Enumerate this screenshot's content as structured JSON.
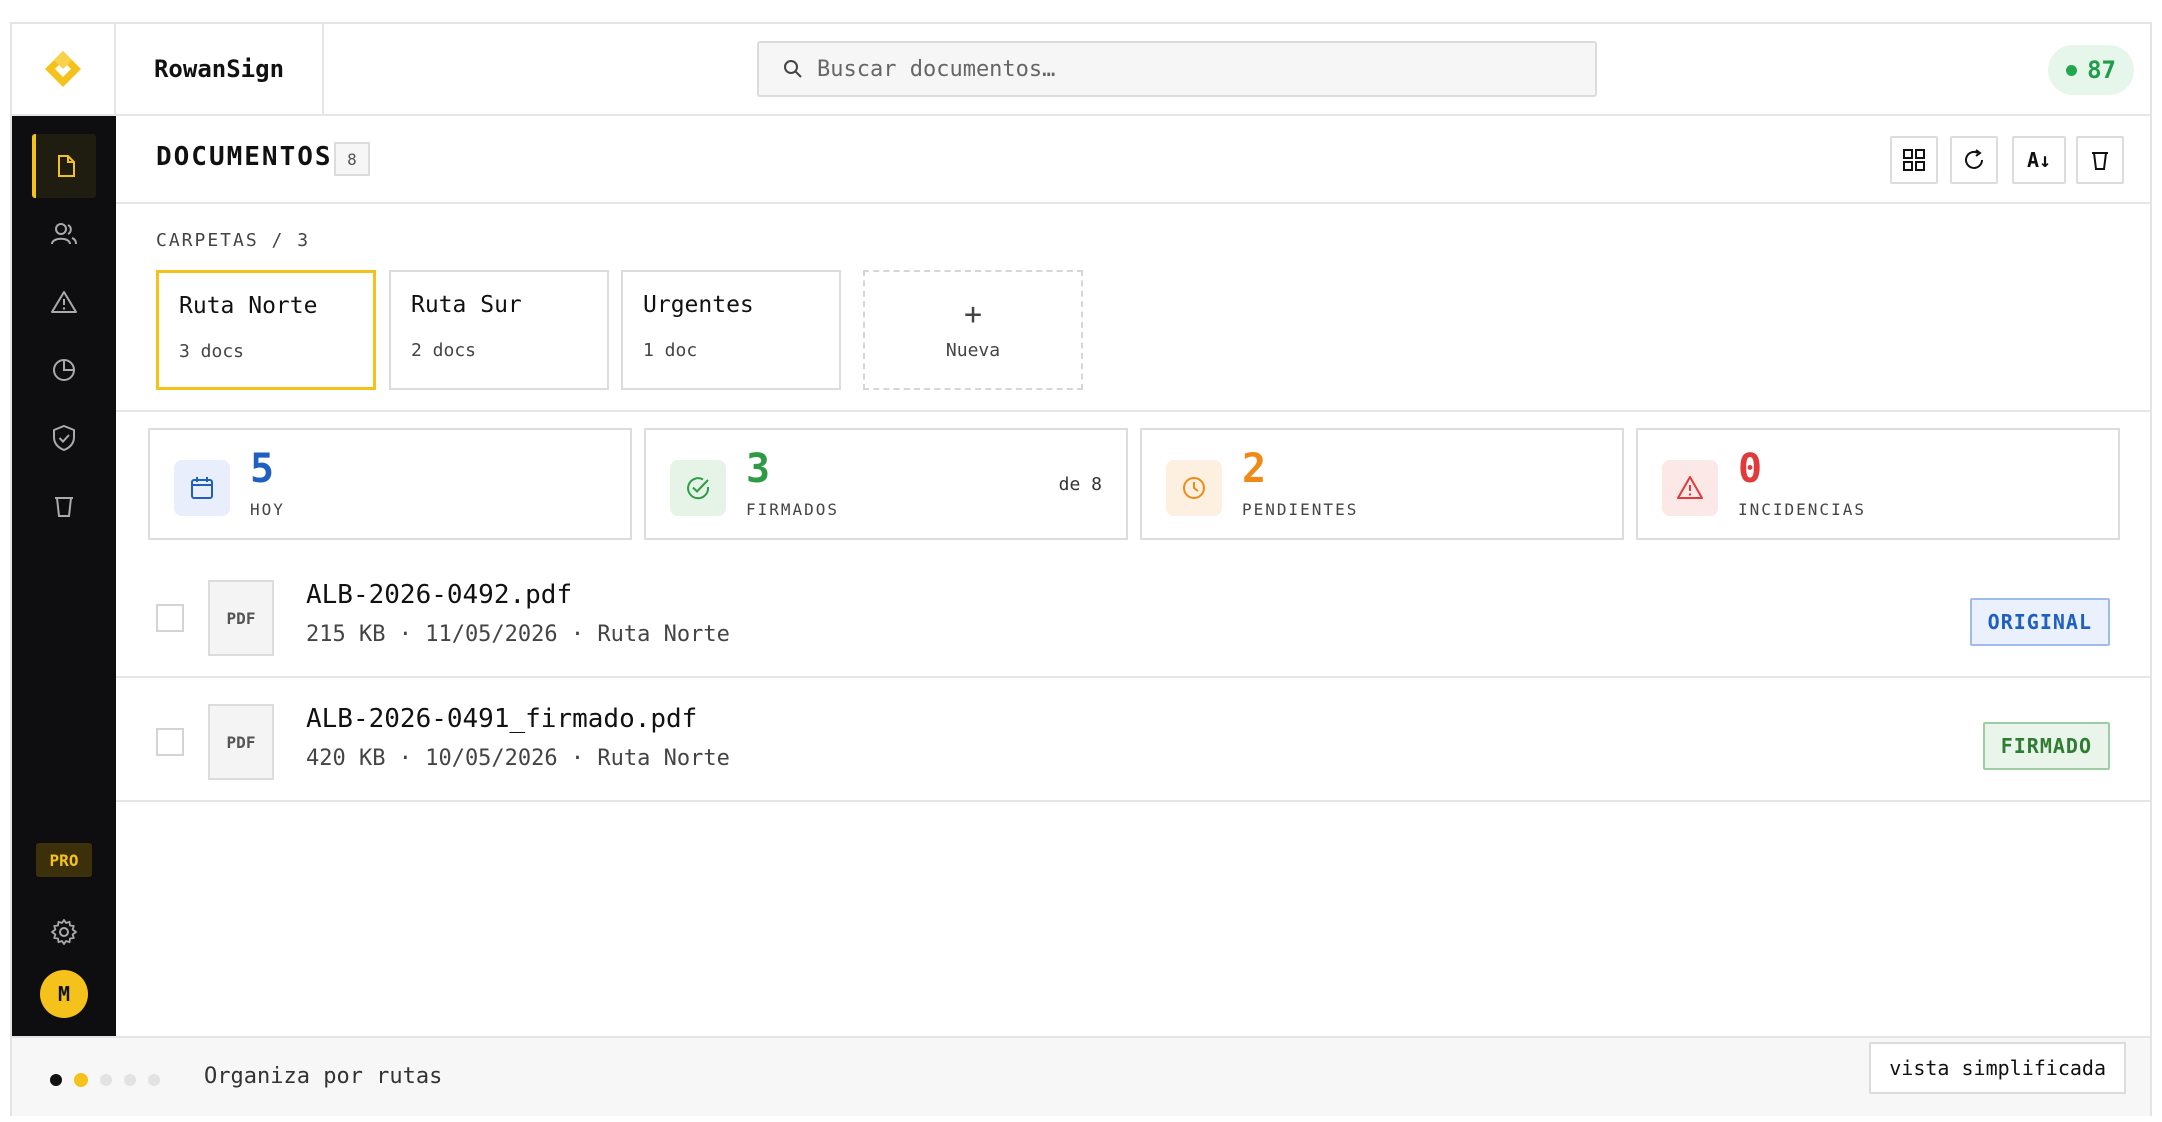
{
  "app": {
    "name": "RowanSign"
  },
  "search": {
    "placeholder": "Buscar documentos…"
  },
  "header": {
    "score": "87",
    "score_color": "#22a650"
  },
  "sidebar": {
    "items": [
      {
        "icon": "document-icon",
        "active": true
      },
      {
        "icon": "users-icon",
        "active": false
      },
      {
        "icon": "warning-icon",
        "active": false
      },
      {
        "icon": "pie-chart-icon",
        "active": false
      },
      {
        "icon": "shield-check-icon",
        "active": false
      },
      {
        "icon": "trash-icon",
        "active": false
      }
    ],
    "pro_label": "PRO",
    "settings_icon": "gear-icon",
    "avatar_initial": "M"
  },
  "main": {
    "title": "DOCUMENTOS",
    "count": "8",
    "toolbar": [
      {
        "icon": "grid-icon"
      },
      {
        "icon": "refresh-icon"
      },
      {
        "icon": "sort-az-icon",
        "label": "A↓"
      },
      {
        "icon": "trash-icon"
      }
    ],
    "folders_label": "CARPETAS / 3",
    "folders": [
      {
        "name": "Ruta Norte",
        "count": "3 docs",
        "selected": true
      },
      {
        "name": "Ruta Sur",
        "count": "2 docs",
        "selected": false
      },
      {
        "name": "Urgentes",
        "count": "1 doc",
        "selected": false
      }
    ],
    "new_folder": {
      "plus": "+",
      "label": "Nueva"
    },
    "stats": [
      {
        "value": "5",
        "label": "HOY",
        "color": "#1f5fbf",
        "bg": "#e8eefb",
        "icon": "calendar-icon"
      },
      {
        "value": "3",
        "label": "FIRMADOS",
        "of": "de 8",
        "color": "#2e9a44",
        "bg": "#e6f4e8",
        "icon": "check-circle-icon"
      },
      {
        "value": "2",
        "label": "PENDIENTES",
        "color": "#ef8a17",
        "bg": "#fdf0e0",
        "icon": "clock-icon"
      },
      {
        "value": "0",
        "label": "INCIDENCIAS",
        "color": "#e03a3a",
        "bg": "#fde8e8",
        "icon": "warning-icon"
      }
    ],
    "documents": [
      {
        "type": "PDF",
        "name": "ALB-2026-0492.pdf",
        "meta": "215 KB · 11/05/2026 · Ruta Norte",
        "status": "ORIGINAL",
        "status_color": "#1f5fbf",
        "status_bg": "#eaf1fd"
      },
      {
        "type": "PDF",
        "name": "ALB-2026-0491_firmado.pdf",
        "meta": "420 KB · 10/05/2026 · Ruta Norte",
        "status": "FIRMADO",
        "status_color": "#2e7d32",
        "status_bg": "#e9f5ea"
      }
    ]
  },
  "footer": {
    "tip": "Organiza por rutas",
    "step_count": 5,
    "current_step": 2,
    "simple_view_label": "vista simplificada"
  },
  "colors": {
    "accent": "#f5c21b",
    "sidebar_bg": "#0e0e10"
  }
}
